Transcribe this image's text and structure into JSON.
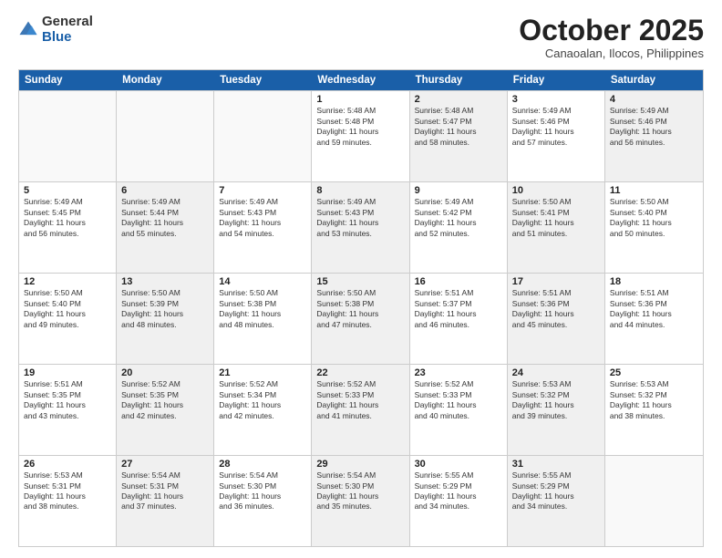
{
  "logo": {
    "general": "General",
    "blue": "Blue"
  },
  "title": "October 2025",
  "subtitle": "Canaoalan, Ilocos, Philippines",
  "header_days": [
    "Sunday",
    "Monday",
    "Tuesday",
    "Wednesday",
    "Thursday",
    "Friday",
    "Saturday"
  ],
  "weeks": [
    [
      {
        "day": "",
        "info": "",
        "shaded": false,
        "empty": true
      },
      {
        "day": "",
        "info": "",
        "shaded": false,
        "empty": true
      },
      {
        "day": "",
        "info": "",
        "shaded": false,
        "empty": true
      },
      {
        "day": "1",
        "info": "Sunrise: 5:48 AM\nSunset: 5:48 PM\nDaylight: 11 hours\nand 59 minutes.",
        "shaded": false,
        "empty": false
      },
      {
        "day": "2",
        "info": "Sunrise: 5:48 AM\nSunset: 5:47 PM\nDaylight: 11 hours\nand 58 minutes.",
        "shaded": true,
        "empty": false
      },
      {
        "day": "3",
        "info": "Sunrise: 5:49 AM\nSunset: 5:46 PM\nDaylight: 11 hours\nand 57 minutes.",
        "shaded": false,
        "empty": false
      },
      {
        "day": "4",
        "info": "Sunrise: 5:49 AM\nSunset: 5:46 PM\nDaylight: 11 hours\nand 56 minutes.",
        "shaded": true,
        "empty": false
      }
    ],
    [
      {
        "day": "5",
        "info": "Sunrise: 5:49 AM\nSunset: 5:45 PM\nDaylight: 11 hours\nand 56 minutes.",
        "shaded": false,
        "empty": false
      },
      {
        "day": "6",
        "info": "Sunrise: 5:49 AM\nSunset: 5:44 PM\nDaylight: 11 hours\nand 55 minutes.",
        "shaded": true,
        "empty": false
      },
      {
        "day": "7",
        "info": "Sunrise: 5:49 AM\nSunset: 5:43 PM\nDaylight: 11 hours\nand 54 minutes.",
        "shaded": false,
        "empty": false
      },
      {
        "day": "8",
        "info": "Sunrise: 5:49 AM\nSunset: 5:43 PM\nDaylight: 11 hours\nand 53 minutes.",
        "shaded": true,
        "empty": false
      },
      {
        "day": "9",
        "info": "Sunrise: 5:49 AM\nSunset: 5:42 PM\nDaylight: 11 hours\nand 52 minutes.",
        "shaded": false,
        "empty": false
      },
      {
        "day": "10",
        "info": "Sunrise: 5:50 AM\nSunset: 5:41 PM\nDaylight: 11 hours\nand 51 minutes.",
        "shaded": true,
        "empty": false
      },
      {
        "day": "11",
        "info": "Sunrise: 5:50 AM\nSunset: 5:40 PM\nDaylight: 11 hours\nand 50 minutes.",
        "shaded": false,
        "empty": false
      }
    ],
    [
      {
        "day": "12",
        "info": "Sunrise: 5:50 AM\nSunset: 5:40 PM\nDaylight: 11 hours\nand 49 minutes.",
        "shaded": false,
        "empty": false
      },
      {
        "day": "13",
        "info": "Sunrise: 5:50 AM\nSunset: 5:39 PM\nDaylight: 11 hours\nand 48 minutes.",
        "shaded": true,
        "empty": false
      },
      {
        "day": "14",
        "info": "Sunrise: 5:50 AM\nSunset: 5:38 PM\nDaylight: 11 hours\nand 48 minutes.",
        "shaded": false,
        "empty": false
      },
      {
        "day": "15",
        "info": "Sunrise: 5:50 AM\nSunset: 5:38 PM\nDaylight: 11 hours\nand 47 minutes.",
        "shaded": true,
        "empty": false
      },
      {
        "day": "16",
        "info": "Sunrise: 5:51 AM\nSunset: 5:37 PM\nDaylight: 11 hours\nand 46 minutes.",
        "shaded": false,
        "empty": false
      },
      {
        "day": "17",
        "info": "Sunrise: 5:51 AM\nSunset: 5:36 PM\nDaylight: 11 hours\nand 45 minutes.",
        "shaded": true,
        "empty": false
      },
      {
        "day": "18",
        "info": "Sunrise: 5:51 AM\nSunset: 5:36 PM\nDaylight: 11 hours\nand 44 minutes.",
        "shaded": false,
        "empty": false
      }
    ],
    [
      {
        "day": "19",
        "info": "Sunrise: 5:51 AM\nSunset: 5:35 PM\nDaylight: 11 hours\nand 43 minutes.",
        "shaded": false,
        "empty": false
      },
      {
        "day": "20",
        "info": "Sunrise: 5:52 AM\nSunset: 5:35 PM\nDaylight: 11 hours\nand 42 minutes.",
        "shaded": true,
        "empty": false
      },
      {
        "day": "21",
        "info": "Sunrise: 5:52 AM\nSunset: 5:34 PM\nDaylight: 11 hours\nand 42 minutes.",
        "shaded": false,
        "empty": false
      },
      {
        "day": "22",
        "info": "Sunrise: 5:52 AM\nSunset: 5:33 PM\nDaylight: 11 hours\nand 41 minutes.",
        "shaded": true,
        "empty": false
      },
      {
        "day": "23",
        "info": "Sunrise: 5:52 AM\nSunset: 5:33 PM\nDaylight: 11 hours\nand 40 minutes.",
        "shaded": false,
        "empty": false
      },
      {
        "day": "24",
        "info": "Sunrise: 5:53 AM\nSunset: 5:32 PM\nDaylight: 11 hours\nand 39 minutes.",
        "shaded": true,
        "empty": false
      },
      {
        "day": "25",
        "info": "Sunrise: 5:53 AM\nSunset: 5:32 PM\nDaylight: 11 hours\nand 38 minutes.",
        "shaded": false,
        "empty": false
      }
    ],
    [
      {
        "day": "26",
        "info": "Sunrise: 5:53 AM\nSunset: 5:31 PM\nDaylight: 11 hours\nand 38 minutes.",
        "shaded": false,
        "empty": false
      },
      {
        "day": "27",
        "info": "Sunrise: 5:54 AM\nSunset: 5:31 PM\nDaylight: 11 hours\nand 37 minutes.",
        "shaded": true,
        "empty": false
      },
      {
        "day": "28",
        "info": "Sunrise: 5:54 AM\nSunset: 5:30 PM\nDaylight: 11 hours\nand 36 minutes.",
        "shaded": false,
        "empty": false
      },
      {
        "day": "29",
        "info": "Sunrise: 5:54 AM\nSunset: 5:30 PM\nDaylight: 11 hours\nand 35 minutes.",
        "shaded": true,
        "empty": false
      },
      {
        "day": "30",
        "info": "Sunrise: 5:55 AM\nSunset: 5:29 PM\nDaylight: 11 hours\nand 34 minutes.",
        "shaded": false,
        "empty": false
      },
      {
        "day": "31",
        "info": "Sunrise: 5:55 AM\nSunset: 5:29 PM\nDaylight: 11 hours\nand 34 minutes.",
        "shaded": true,
        "empty": false
      },
      {
        "day": "",
        "info": "",
        "shaded": false,
        "empty": true
      }
    ]
  ]
}
